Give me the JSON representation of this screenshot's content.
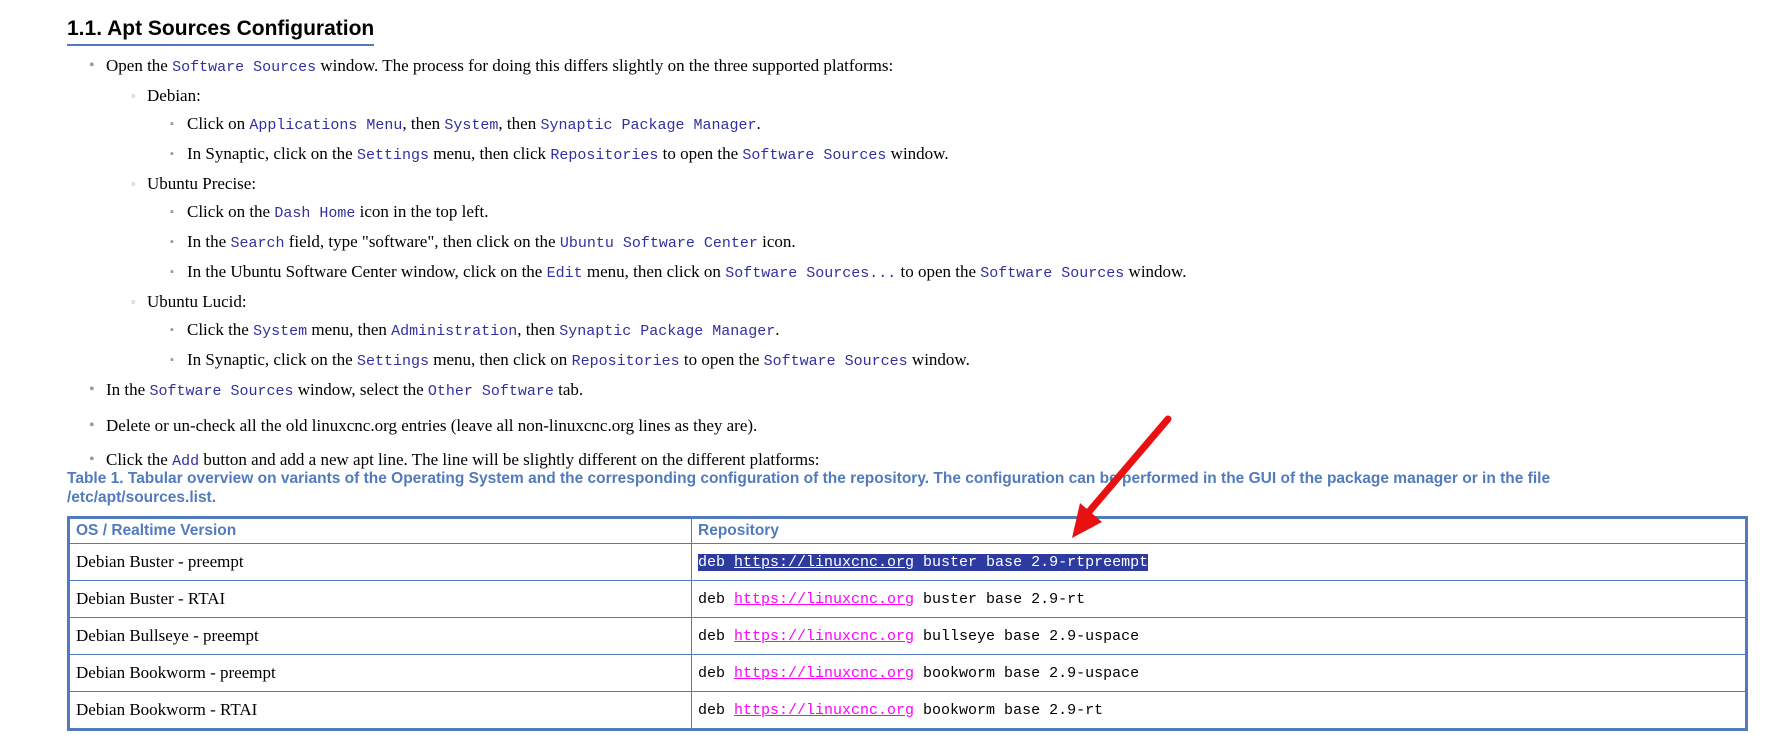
{
  "section_title": "1.1. Apt Sources Configuration",
  "steps": {
    "s1": {
      "t0": "Open the ",
      "c0": "Software Sources",
      "t1": " window. The process for doing this differs slightly on the three supported platforms:"
    },
    "debian": {
      "label": "Debian:",
      "a": {
        "t0": "Click on ",
        "c0": "Applications Menu",
        "t1": ", then ",
        "c1": "System",
        "t2": ", then ",
        "c2": "Synaptic Package Manager",
        "t3": "."
      },
      "b": {
        "t0": "In Synaptic, click on the ",
        "c0": "Settings",
        "t1": " menu, then click ",
        "c1": "Repositories",
        "t2": " to open the ",
        "c2": "Software Sources",
        "t3": " window."
      }
    },
    "precise": {
      "label": "Ubuntu Precise:",
      "a": {
        "t0": "Click on the ",
        "c0": "Dash Home",
        "t1": " icon in the top left."
      },
      "b": {
        "t0": "In the ",
        "c0": "Search",
        "t1": " field, type \"software\", then click on the ",
        "c1": "Ubuntu Software Center",
        "t2": " icon."
      },
      "c": {
        "t0": "In the Ubuntu Software Center window, click on the ",
        "c0": "Edit",
        "t1": " menu, then click on ",
        "c1": "Software Sources...",
        "t2": " to open the ",
        "c2": "Software Sources",
        "t3": " window."
      }
    },
    "lucid": {
      "label": "Ubuntu Lucid:",
      "a": {
        "t0": "Click the ",
        "c0": "System",
        "t1": " menu, then ",
        "c1": "Administration",
        "t2": ", then ",
        "c2": "Synaptic Package Manager",
        "t3": "."
      },
      "b": {
        "t0": "In Synaptic, click on the ",
        "c0": "Settings",
        "t1": " menu, then click on ",
        "c1": "Repositories",
        "t2": " to open the ",
        "c2": "Software Sources",
        "t3": " window."
      }
    },
    "s2": {
      "t0": "In the ",
      "c0": "Software Sources",
      "t1": " window, select the ",
      "c1": "Other Software",
      "t2": " tab."
    },
    "s3": {
      "t0": "Delete or un-check all the old linuxcnc.org entries (leave all non-linuxcnc.org lines as they are)."
    },
    "s4": {
      "t0": "Click the ",
      "c0": "Add",
      "t1": " button and add a new apt line. The line will be slightly different on the different platforms:"
    }
  },
  "table": {
    "caption": "Table 1. Tabular overview on variants of the Operating System and the corresponding configuration of the repository. The configuration can be performed in the GUI of the package manager or in the file /etc/apt/sources.list.",
    "headers": [
      "OS / Realtime Version",
      "Repository"
    ],
    "rows": [
      {
        "os": "Debian Buster - preempt",
        "pre": "deb ",
        "url": "https://linuxcnc.org",
        "post": " buster base 2.9-rtpreempt",
        "selected": true
      },
      {
        "os": "Debian Buster - RTAI",
        "pre": "deb ",
        "url": "https://linuxcnc.org",
        "post": " buster base 2.9-rt"
      },
      {
        "os": "Debian Bullseye - preempt",
        "pre": "deb ",
        "url": "https://linuxcnc.org",
        "post": " bullseye base 2.9-uspace"
      },
      {
        "os": "Debian Bookworm - preempt",
        "pre": "deb ",
        "url": "https://linuxcnc.org",
        "post": " bookworm base 2.9-uspace"
      },
      {
        "os": "Debian Bookworm - RTAI",
        "pre": "deb ",
        "url": "https://linuxcnc.org",
        "post": " bookworm base 2.9-rt"
      }
    ]
  },
  "colors": {
    "accent": "#527bbd",
    "literal": "#3030a0",
    "link": "#ff00ff",
    "selection": "#2d3aa0",
    "annotation_arrow": "#e81010"
  },
  "icons": {
    "bullet_level1": "•",
    "bullet_level2": "◦",
    "bullet_level3": "▪",
    "annotation": "red-arrow-icon"
  }
}
